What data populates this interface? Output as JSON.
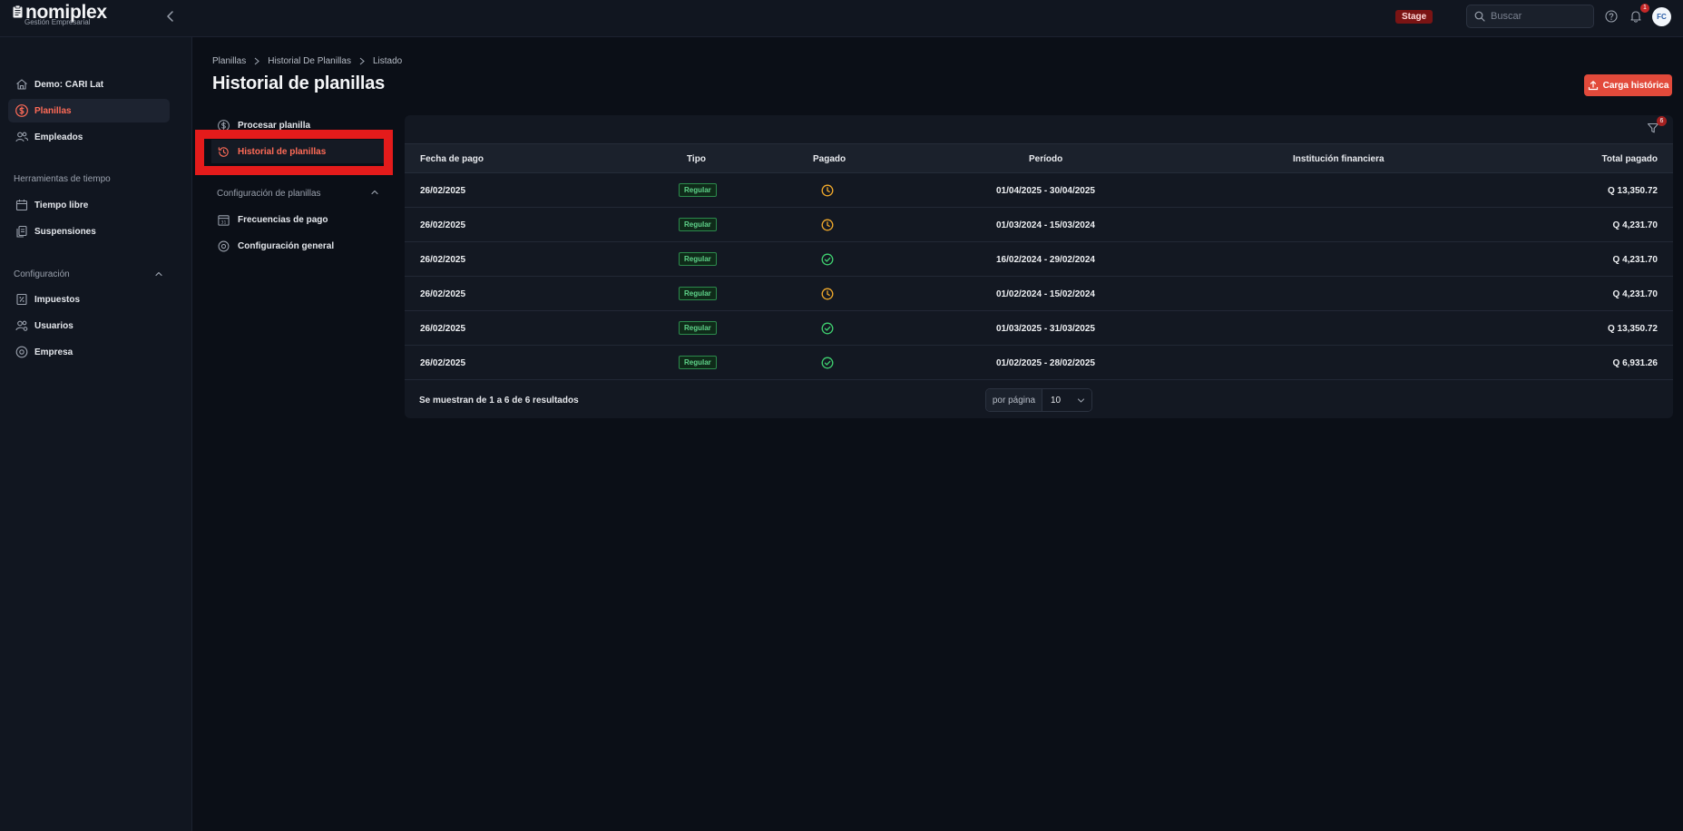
{
  "app": {
    "name": "nomiplex",
    "subtitle": "Gestión Empresarial",
    "environment_badge": "Stage",
    "search_placeholder": "Buscar",
    "notifications_count": "1",
    "user_initials": "FC"
  },
  "sidebar": {
    "items_top": [
      {
        "label": "Demo: CARI Lat",
        "icon": "home-icon"
      },
      {
        "label": "Planillas",
        "icon": "dollar-circle-icon",
        "active": true
      },
      {
        "label": "Empleados",
        "icon": "users-icon"
      }
    ],
    "section_time": "Herramientas de tiempo",
    "items_time": [
      {
        "label": "Tiempo libre",
        "icon": "calendar-icon"
      },
      {
        "label": "Suspensiones",
        "icon": "document-icon"
      }
    ],
    "section_config": "Configuración",
    "items_config": [
      {
        "label": "Impuestos",
        "icon": "tax-document-icon"
      },
      {
        "label": "Usuarios",
        "icon": "users-gear-icon"
      },
      {
        "label": "Empresa",
        "icon": "gear-icon"
      }
    ]
  },
  "breadcrumb": [
    "Planillas",
    "Historial De Planillas",
    "Listado"
  ],
  "page_title": "Historial de planillas",
  "actions": {
    "carga_historica": "Carga histórica"
  },
  "subnav": {
    "items": [
      {
        "label": "Procesar planilla",
        "icon": "dollar-circle-icon"
      },
      {
        "label": "Historial de planillas",
        "icon": "history-icon",
        "active": true
      }
    ],
    "config_section": "Configuración de planillas",
    "config_items": [
      {
        "label": "Frecuencias de pago",
        "icon": "calendar-31-icon"
      },
      {
        "label": "Configuración general",
        "icon": "gear-icon"
      }
    ]
  },
  "table": {
    "filter_count": "6",
    "columns": [
      "Fecha de pago",
      "Tipo",
      "Pagado",
      "Período",
      "Institución financiera",
      "Total pagado"
    ],
    "rows": [
      {
        "fecha": "26/02/2025",
        "tipo": "Regular",
        "pagado": "pending",
        "periodo": "01/04/2025 - 30/04/2025",
        "institucion": "",
        "total": "Q 13,350.72"
      },
      {
        "fecha": "26/02/2025",
        "tipo": "Regular",
        "pagado": "pending",
        "periodo": "01/03/2024 - 15/03/2024",
        "institucion": "",
        "total": "Q 4,231.70"
      },
      {
        "fecha": "26/02/2025",
        "tipo": "Regular",
        "pagado": "paid",
        "periodo": "16/02/2024 - 29/02/2024",
        "institucion": "",
        "total": "Q 4,231.70"
      },
      {
        "fecha": "26/02/2025",
        "tipo": "Regular",
        "pagado": "pending",
        "periodo": "01/02/2024 - 15/02/2024",
        "institucion": "",
        "total": "Q 4,231.70"
      },
      {
        "fecha": "26/02/2025",
        "tipo": "Regular",
        "pagado": "paid",
        "periodo": "01/03/2025 - 31/03/2025",
        "institucion": "",
        "total": "Q 13,350.72"
      },
      {
        "fecha": "26/02/2025",
        "tipo": "Regular",
        "pagado": "paid",
        "periodo": "01/02/2025 - 28/02/2025",
        "institucion": "",
        "total": "Q 6,931.26"
      }
    ],
    "footer_text": "Se muestran de 1 a 6 de 6 resultados",
    "per_page_label": "por página",
    "per_page_value": "10"
  },
  "colors": {
    "accent": "#e24a3b",
    "active_text": "#ff6b57",
    "pending": "#f0a92b",
    "paid": "#3fcf6f",
    "highlight": "#e41b1b"
  }
}
